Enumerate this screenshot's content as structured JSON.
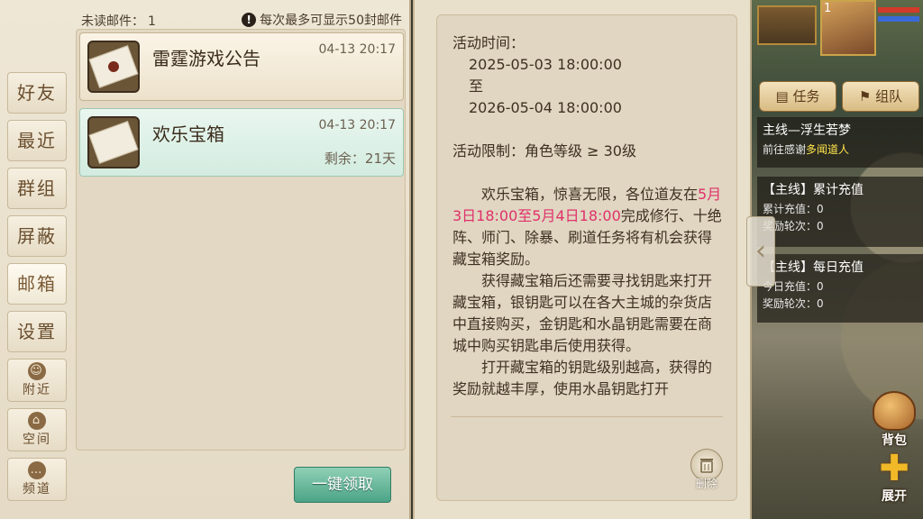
{
  "mailbox": {
    "unread_label": "未读邮件：",
    "unread_count": "1",
    "limit_icon": "exclamation-icon",
    "limit_text": "每次最多可显示50封邮件"
  },
  "tabs": [
    {
      "label": "好友"
    },
    {
      "label": "最近"
    },
    {
      "label": "群组"
    },
    {
      "label": "屏蔽"
    },
    {
      "label": "邮箱"
    },
    {
      "label": "设置"
    },
    {
      "label": "附近",
      "icon": "nearby-person-icon"
    },
    {
      "label": "空间",
      "icon": "home-icon"
    },
    {
      "label": "频道",
      "icon": "chat-bubble-icon"
    }
  ],
  "mails": [
    {
      "title": "雷霆游戏公告",
      "time": "04-13 20:17",
      "remaining": "",
      "icon": "sealed-envelope-icon"
    },
    {
      "title": "欢乐宝箱",
      "time": "04-13 20:17",
      "remaining": "剩余：21天",
      "icon": "opened-letter-icon"
    }
  ],
  "claim_all_label": "一键领取",
  "detail": {
    "time_label": "活动时间：",
    "start": "2025-05-03 18:00:00",
    "to": "至",
    "end": "2026-05-04 18:00:00",
    "limit": "活动限制：角色等级 ≥ 30级",
    "p1_a": "欢乐宝箱，惊喜无限，各位道友在",
    "p1_hl": "5月3日18:00至5月4日18:00",
    "p1_b": "完成修行、十绝阵、师门、除暴、刷道任务将有机会获得藏宝箱奖励。",
    "p2": "获得藏宝箱后还需要寻找钥匙来打开藏宝箱，银钥匙可以在各大主城的杂货店中直接购买，金钥匙和水晶钥匙需要在商城中购买钥匙串后使用获得。",
    "p3": "打开藏宝箱的钥匙级别越高，获得的奖励就越丰厚，使用水晶钥匙打开",
    "delete_label": "删除"
  },
  "hud": {
    "level": "1",
    "quest_tab": "任务",
    "team_tab": "组队",
    "quests": [
      {
        "title": "主线—浮生若梦",
        "line1_a": "前往感谢",
        "line1_b": "多闻道人"
      },
      {
        "title": "【主线】累计充值",
        "line1": "累计充值：0",
        "line2": "奖励轮次：0"
      },
      {
        "title": "【主线】每日充值",
        "line1": "今日充值：0",
        "line2": "奖励轮次：0"
      }
    ],
    "bag_label": "背包",
    "expand_label": "展开",
    "hp_color": "#d23a2a",
    "mp_color": "#3a6ad8"
  }
}
